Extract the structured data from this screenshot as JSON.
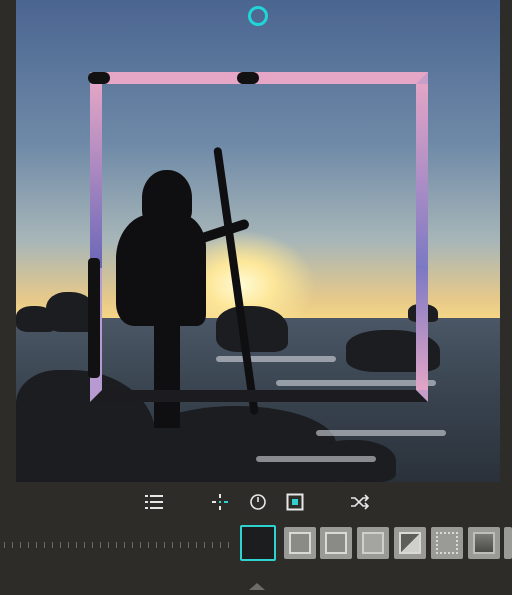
{
  "app": {
    "colors": {
      "accent": "#2ed3d0",
      "background": "#2d2c28",
      "frame_top": "#e6a6c6",
      "frame_side": "#b79ad2"
    }
  },
  "photo": {
    "subject": "silhouette-at-sunset"
  },
  "toolbar": {
    "items": [
      {
        "icon": "list-icon"
      },
      {
        "icon": "move-arrows-icon"
      },
      {
        "icon": "clock-icon"
      },
      {
        "icon": "square-frame-icon"
      },
      {
        "icon": "shuffle-icon"
      }
    ]
  },
  "frames": {
    "selected_index": 0,
    "items": [
      {
        "style": "blank"
      },
      {
        "style": "square-light"
      },
      {
        "style": "square-light-2"
      },
      {
        "style": "square-flat"
      },
      {
        "style": "square-bevel"
      },
      {
        "style": "square-ornate"
      },
      {
        "style": "square-dark"
      },
      {
        "style": "partial"
      }
    ]
  }
}
